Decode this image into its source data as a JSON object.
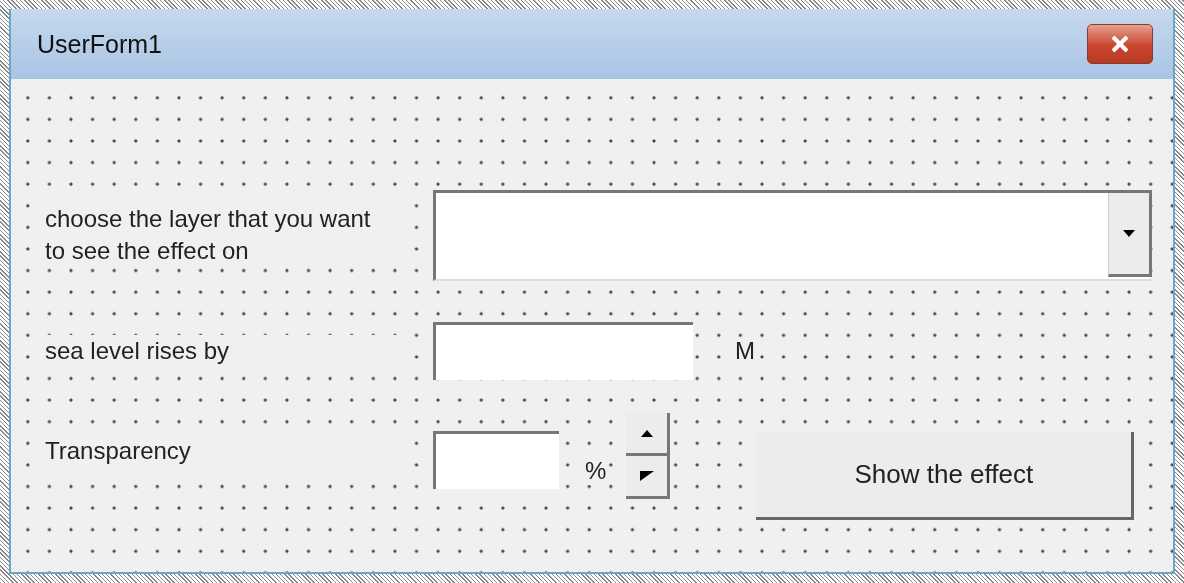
{
  "window": {
    "title": "UserForm1"
  },
  "rows": [
    {
      "kind": "combo",
      "label": "choose the layer that you want to see the effect on"
    },
    {
      "kind": "text",
      "label": "sea level rises by",
      "unit": "M"
    },
    {
      "kind": "spin",
      "label": "Transparency",
      "unit": "%",
      "button": "Show the effect"
    }
  ]
}
